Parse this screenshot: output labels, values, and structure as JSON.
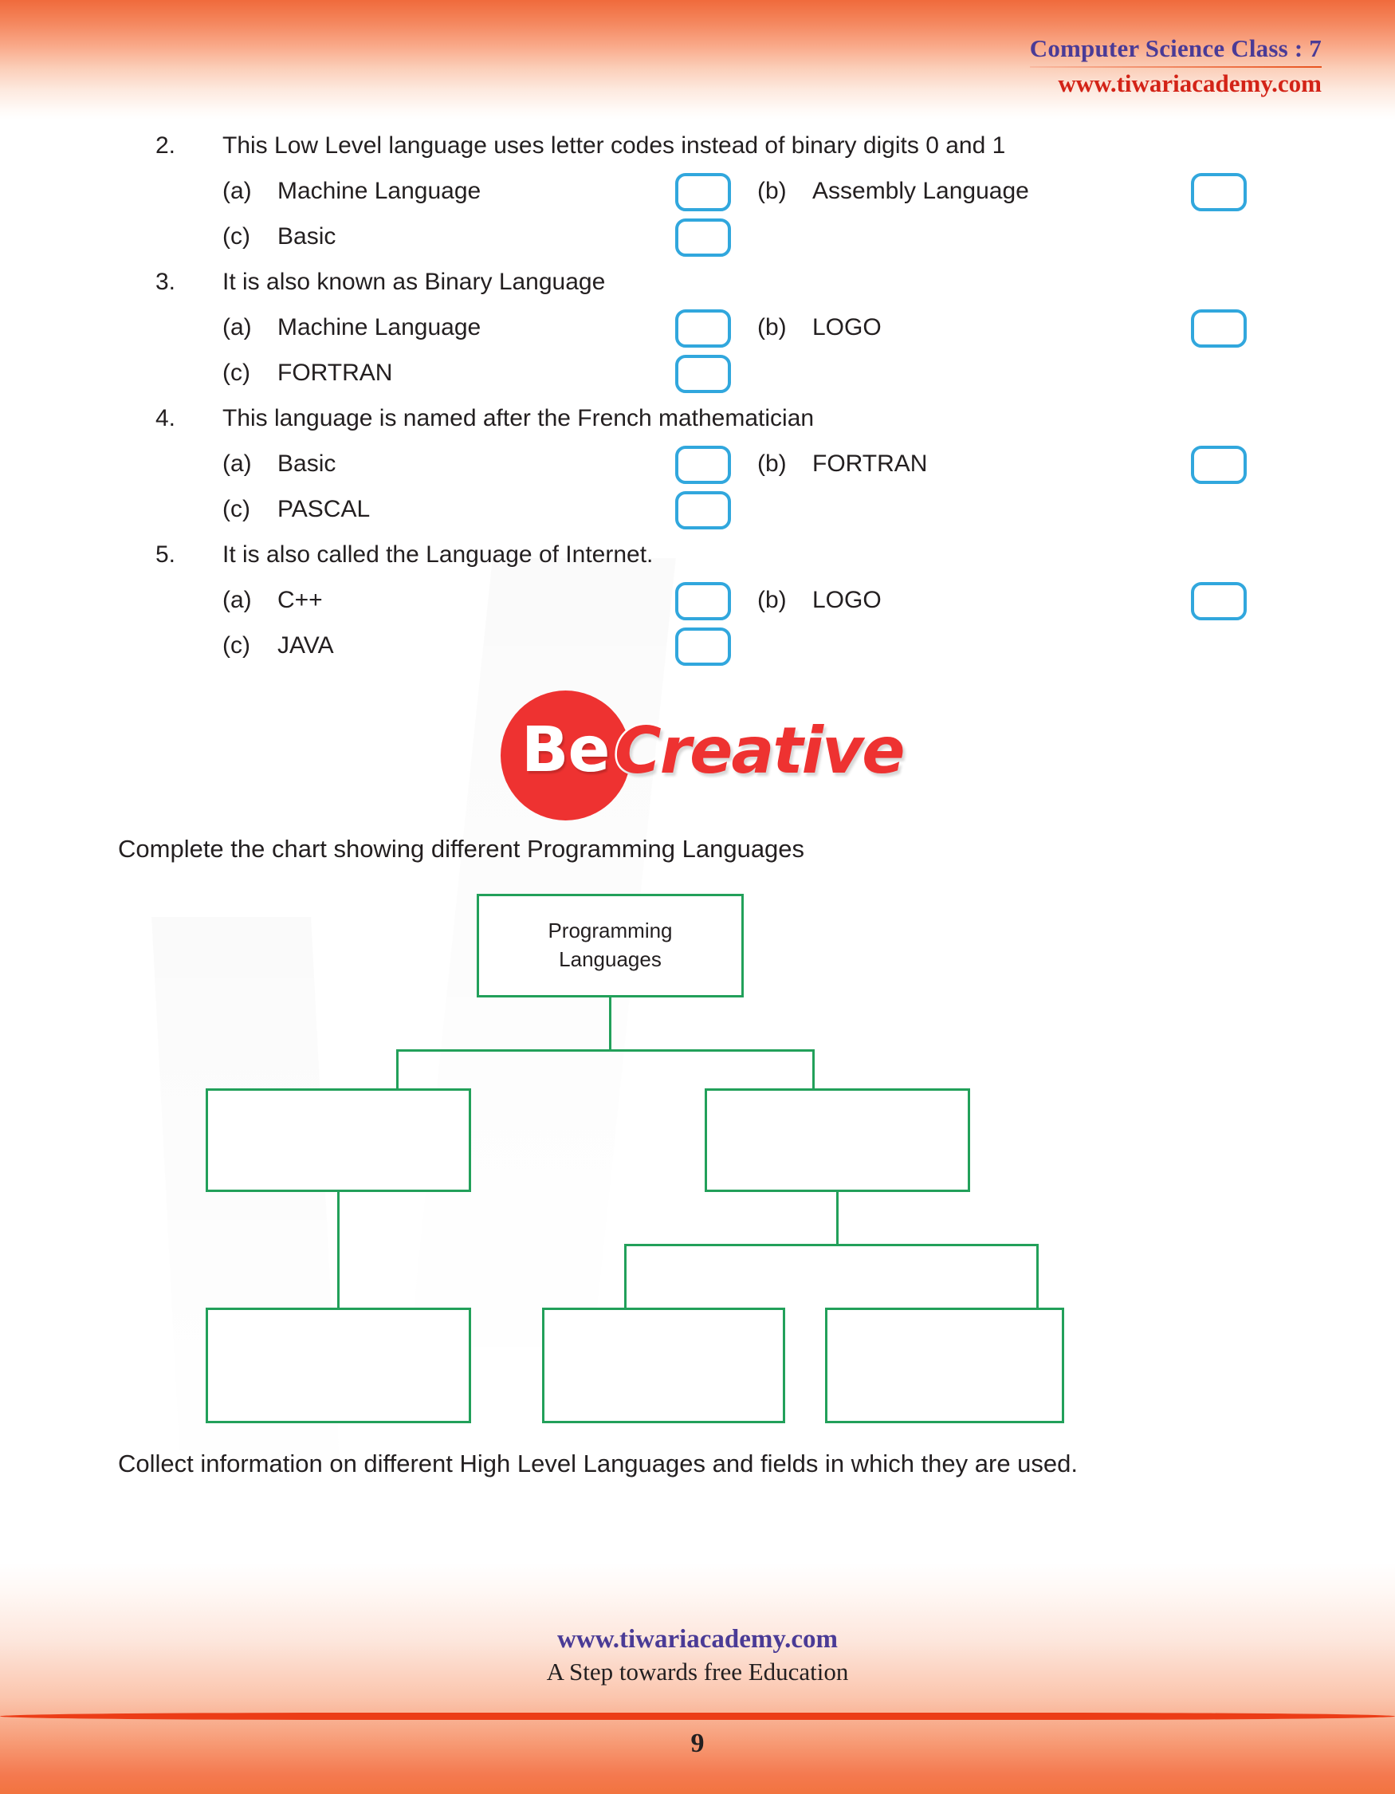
{
  "header": {
    "title": "Computer Science Class : 7",
    "site": "www.tiwariacademy.com"
  },
  "questions": [
    {
      "number": "2.",
      "text": "This Low Level language uses letter codes instead of binary digits 0 and 1",
      "options": [
        {
          "label": "(a)",
          "text": "Machine Language"
        },
        {
          "label": "(b)",
          "text": "Assembly Language"
        },
        {
          "label": "(c)",
          "text": "Basic"
        }
      ]
    },
    {
      "number": "3.",
      "text": "It is also known as Binary Language",
      "options": [
        {
          "label": "(a)",
          "text": "Machine Language"
        },
        {
          "label": "(b)",
          "text": "LOGO"
        },
        {
          "label": "(c)",
          "text": "FORTRAN"
        }
      ]
    },
    {
      "number": "4.",
      "text": "This language is named after the French mathematician",
      "options": [
        {
          "label": "(a)",
          "text": "Basic"
        },
        {
          "label": "(b)",
          "text": "FORTRAN"
        },
        {
          "label": "(c)",
          "text": "PASCAL"
        }
      ]
    },
    {
      "number": "5.",
      "text": "It is also called the Language of Internet.",
      "options": [
        {
          "label": "(a)",
          "text": "C++"
        },
        {
          "label": "(b)",
          "text": "LOGO"
        },
        {
          "label": "(c)",
          "text": "JAVA"
        }
      ]
    }
  ],
  "logo": {
    "be": "Be",
    "creative": "Creative",
    "circle_color": "#ee3231",
    "text_color": "#ee3231"
  },
  "instructions": {
    "chart": "Complete the chart showing different Programming Languages",
    "collect": "Collect information on different High Level Languages and fields in which they are used."
  },
  "chart_data": {
    "type": "diagram",
    "title": "Complete the chart showing different Programming Languages",
    "border_color": "#22a05a",
    "nodes": [
      {
        "id": "root",
        "label": "Programming\nLanguages",
        "line1": "Programming",
        "line2": "Languages",
        "filled": true
      },
      {
        "id": "l2a",
        "label": "",
        "filled": false
      },
      {
        "id": "l2b",
        "label": "",
        "filled": false
      },
      {
        "id": "l3a",
        "label": "",
        "filled": false
      },
      {
        "id": "l3b",
        "label": "",
        "filled": false
      },
      {
        "id": "l3c",
        "label": "",
        "filled": false
      }
    ],
    "edges": [
      {
        "from": "root",
        "to": "l2a"
      },
      {
        "from": "root",
        "to": "l2b"
      },
      {
        "from": "l2a",
        "to": "l3a"
      },
      {
        "from": "l2b",
        "to": "l3b"
      },
      {
        "from": "l2b",
        "to": "l3c"
      }
    ]
  },
  "footer": {
    "site": "www.tiwariacademy.com",
    "tagline": "A Step towards free Education",
    "page_number": "9"
  }
}
